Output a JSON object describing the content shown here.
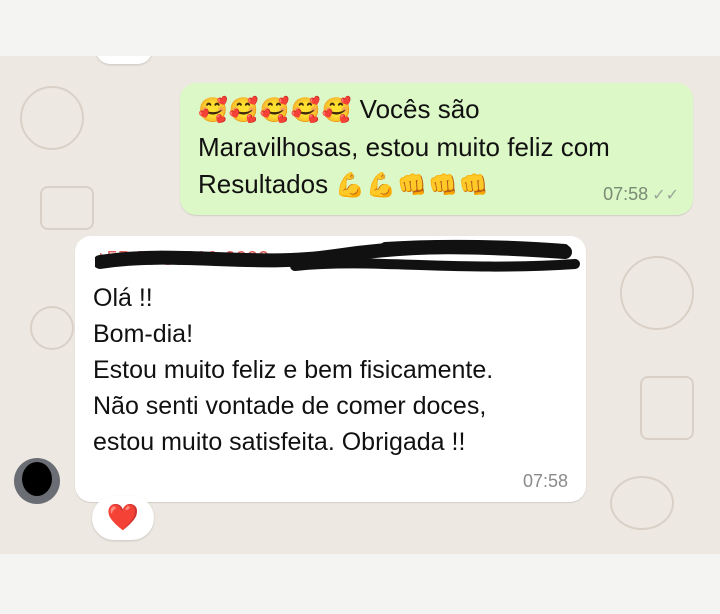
{
  "outgoing": {
    "emoji_prefix": "🥰🥰🥰🥰🥰",
    "text_line1": "Vocês são",
    "text_line2": "Maravilhosas, estou muito feliz com",
    "text_line3": "Resultados",
    "emoji_suffix": "💪💪👊👊👊",
    "time": "07:58",
    "status_icon": "double-check-icon",
    "ticks_glyph": "✓✓"
  },
  "incoming": {
    "sender": "+55 00 00000-0000",
    "lines": [
      "Olá !!",
      "Bom-dia!",
      "Estou muito feliz e bem fisicamente.",
      "Não senti vontade de comer doces,",
      "estou muito satisfeita. Obrigada !!"
    ],
    "time": "07:58",
    "reaction": "❤️"
  },
  "colors": {
    "outgoing_bubble": "#dcf8c6",
    "incoming_bubble": "#ffffff",
    "chat_background": "#ede8e1",
    "sender_name": "#e06060"
  }
}
